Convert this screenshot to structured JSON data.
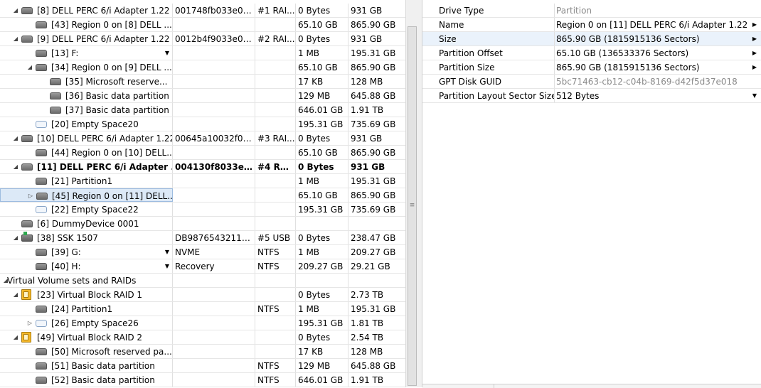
{
  "tree": {
    "rows": [
      {
        "name": "[8] DELL PERC 6/i Adapter 1.22",
        "id": "001748fb033e00...",
        "fs": "#1 RAI...",
        "start": "0 Bytes",
        "size": "931 GB",
        "level": 1,
        "expander": "open",
        "icon": "disk",
        "icon_name": "hard-disk-icon"
      },
      {
        "name": "[43] Region 0 on [8] DELL ...",
        "id": "",
        "fs": "",
        "start": "65.10 GB",
        "size": "865.90 GB",
        "level": 2,
        "expander": "none",
        "icon": "disk",
        "icon_name": "partition-icon"
      },
      {
        "name": "[9] DELL PERC 6/i Adapter 1.22",
        "id": "0012b4f9033e00...",
        "fs": "#2 RAI...",
        "start": "0 Bytes",
        "size": "931 GB",
        "level": 1,
        "expander": "open",
        "icon": "disk",
        "icon_name": "hard-disk-icon"
      },
      {
        "name": "[13] F:",
        "id": "",
        "fs": "",
        "start": "1 MB",
        "size": "195.31 GB",
        "level": 2,
        "expander": "none",
        "icon": "disk",
        "icon_name": "partition-icon",
        "dropdown": true
      },
      {
        "name": "[34] Region 0 on [9] DELL ...",
        "id": "",
        "fs": "",
        "start": "65.10 GB",
        "size": "865.90 GB",
        "level": 2,
        "expander": "open",
        "icon": "disk",
        "icon_name": "partition-icon"
      },
      {
        "name": "[35] Microsoft reserve...",
        "id": "",
        "fs": "",
        "start": "17 KB",
        "size": "128 MB",
        "level": 3,
        "expander": "none",
        "icon": "disk",
        "icon_name": "partition-icon"
      },
      {
        "name": "[36] Basic data partition",
        "id": "",
        "fs": "",
        "start": "129 MB",
        "size": "645.88 GB",
        "level": 3,
        "expander": "none",
        "icon": "disk",
        "icon_name": "partition-icon"
      },
      {
        "name": "[37] Basic data partition",
        "id": "",
        "fs": "",
        "start": "646.01 GB",
        "size": "1.91 TB",
        "level": 3,
        "expander": "none",
        "icon": "disk",
        "icon_name": "partition-icon"
      },
      {
        "name": "[20] Empty Space20",
        "id": "",
        "fs": "",
        "start": "195.31 GB",
        "size": "735.69 GB",
        "level": 2,
        "expander": "none",
        "icon": "empty",
        "icon_name": "empty-space-icon"
      },
      {
        "name": "[10] DELL PERC 6/i Adapter 1.22",
        "id": "00645a10032f00...",
        "fs": "#3 RAI...",
        "start": "0 Bytes",
        "size": "931 GB",
        "level": 1,
        "expander": "open",
        "icon": "disk",
        "icon_name": "hard-disk-icon"
      },
      {
        "name": "[44] Region 0 on [10] DELL...",
        "id": "",
        "fs": "",
        "start": "65.10 GB",
        "size": "865.90 GB",
        "level": 2,
        "expander": "none",
        "icon": "disk",
        "icon_name": "partition-icon"
      },
      {
        "name": "[11] DELL PERC 6/i Adapter ...",
        "id": "004130f8033e00...",
        "fs": "#4 RA...",
        "start": "0 Bytes",
        "size": "931 GB",
        "level": 1,
        "expander": "open",
        "icon": "disk",
        "icon_name": "hard-disk-icon",
        "bold": true
      },
      {
        "name": "[21] Partition1",
        "id": "",
        "fs": "",
        "start": "1 MB",
        "size": "195.31 GB",
        "level": 2,
        "expander": "none",
        "icon": "disk",
        "icon_name": "partition-icon"
      },
      {
        "name": "[45] Region 0 on [11] DELL...",
        "id": "",
        "fs": "",
        "start": "65.10 GB",
        "size": "865.90 GB",
        "level": 2,
        "expander": "closed",
        "icon": "disk",
        "icon_name": "partition-icon",
        "selected": true
      },
      {
        "name": "[22] Empty Space22",
        "id": "",
        "fs": "",
        "start": "195.31 GB",
        "size": "735.69 GB",
        "level": 2,
        "expander": "none",
        "icon": "empty",
        "icon_name": "empty-space-icon"
      },
      {
        "name": "[6] DummyDevice 0001",
        "id": "",
        "fs": "",
        "start": "",
        "size": "",
        "level": 1,
        "expander": "none",
        "icon": "disk",
        "icon_name": "hard-disk-icon"
      },
      {
        "name": "[38] SSK 1507",
        "id": "DB98765432111ED",
        "fs": "#5 USB",
        "start": "0 Bytes",
        "size": "238.47 GB",
        "level": 1,
        "expander": "open",
        "icon": "usb",
        "icon_name": "usb-drive-icon"
      },
      {
        "name": "[39] G:",
        "id": "NVME",
        "fs": "NTFS",
        "start": "1 MB",
        "size": "209.27 GB",
        "level": 2,
        "expander": "none",
        "icon": "disk",
        "icon_name": "partition-icon",
        "dropdown": true
      },
      {
        "name": "[40] H:",
        "id": "Recovery",
        "fs": "NTFS",
        "start": "209.27 GB",
        "size": "29.21 GB",
        "level": 2,
        "expander": "none",
        "icon": "disk",
        "icon_name": "partition-icon",
        "dropdown": true
      },
      {
        "name": "Virtual Volume sets and RAIDs",
        "id": "",
        "fs": "",
        "start": "",
        "size": "",
        "level": 0,
        "expander": "open",
        "icon": "none",
        "icon_name": ""
      },
      {
        "name": "[23] Virtual Block RAID 1",
        "id": "",
        "fs": "",
        "start": "0 Bytes",
        "size": "2.73 TB",
        "level": 1,
        "expander": "open",
        "icon": "raid",
        "icon_name": "raid-icon"
      },
      {
        "name": "[24] Partition1",
        "id": "",
        "fs": "NTFS",
        "start": "1 MB",
        "size": "195.31 GB",
        "level": 2,
        "expander": "none",
        "icon": "disk",
        "icon_name": "partition-icon"
      },
      {
        "name": "[26] Empty Space26",
        "id": "",
        "fs": "",
        "start": "195.31 GB",
        "size": "1.81 TB",
        "level": 2,
        "expander": "closed",
        "icon": "empty",
        "icon_name": "empty-space-icon"
      },
      {
        "name": "[49] Virtual Block RAID 2",
        "id": "",
        "fs": "",
        "start": "0 Bytes",
        "size": "2.54 TB",
        "level": 1,
        "expander": "open",
        "icon": "raid",
        "icon_name": "raid-icon"
      },
      {
        "name": "[50] Microsoft reserved pa...",
        "id": "",
        "fs": "",
        "start": "17 KB",
        "size": "128 MB",
        "level": 2,
        "expander": "none",
        "icon": "disk",
        "icon_name": "partition-icon"
      },
      {
        "name": "[51] Basic data partition",
        "id": "",
        "fs": "NTFS",
        "start": "129 MB",
        "size": "645.88 GB",
        "level": 2,
        "expander": "none",
        "icon": "disk",
        "icon_name": "partition-icon"
      },
      {
        "name": "[52] Basic data partition",
        "id": "",
        "fs": "NTFS",
        "start": "646.01 GB",
        "size": "1.91 TB",
        "level": 2,
        "expander": "none",
        "icon": "disk",
        "icon_name": "partition-icon"
      }
    ]
  },
  "properties": {
    "rows": [
      {
        "key": "Drive Type",
        "value": "Partition",
        "grey": true,
        "arrow": ""
      },
      {
        "key": "Name",
        "value": "Region 0 on [11] DELL PERC 6/i Adapter 1.22",
        "grey": false,
        "arrow": "right"
      },
      {
        "key": "Size",
        "value": "865.90 GB (1815915136 Sectors)",
        "grey": false,
        "arrow": "right",
        "selected": true
      },
      {
        "key": "Partition Offset",
        "value": "65.10 GB (136533376 Sectors)",
        "grey": false,
        "arrow": "right"
      },
      {
        "key": "Partition Size",
        "value": "865.90 GB (1815915136 Sectors)",
        "grey": false,
        "arrow": "right"
      },
      {
        "key": "GPT Disk GUID",
        "value": "5bc71463-cb12-c04b-8169-d42f5d37e018",
        "grey": true,
        "arrow": ""
      },
      {
        "key": "Partition Layout Sector Size",
        "value": "512 Bytes",
        "grey": false,
        "arrow": "down"
      }
    ]
  },
  "colors": {
    "selection_fill": "#dce9f7",
    "selection_border": "#9dbce0",
    "grid_line": "#e6e6e6",
    "grey_text": "#8a8a8a"
  }
}
